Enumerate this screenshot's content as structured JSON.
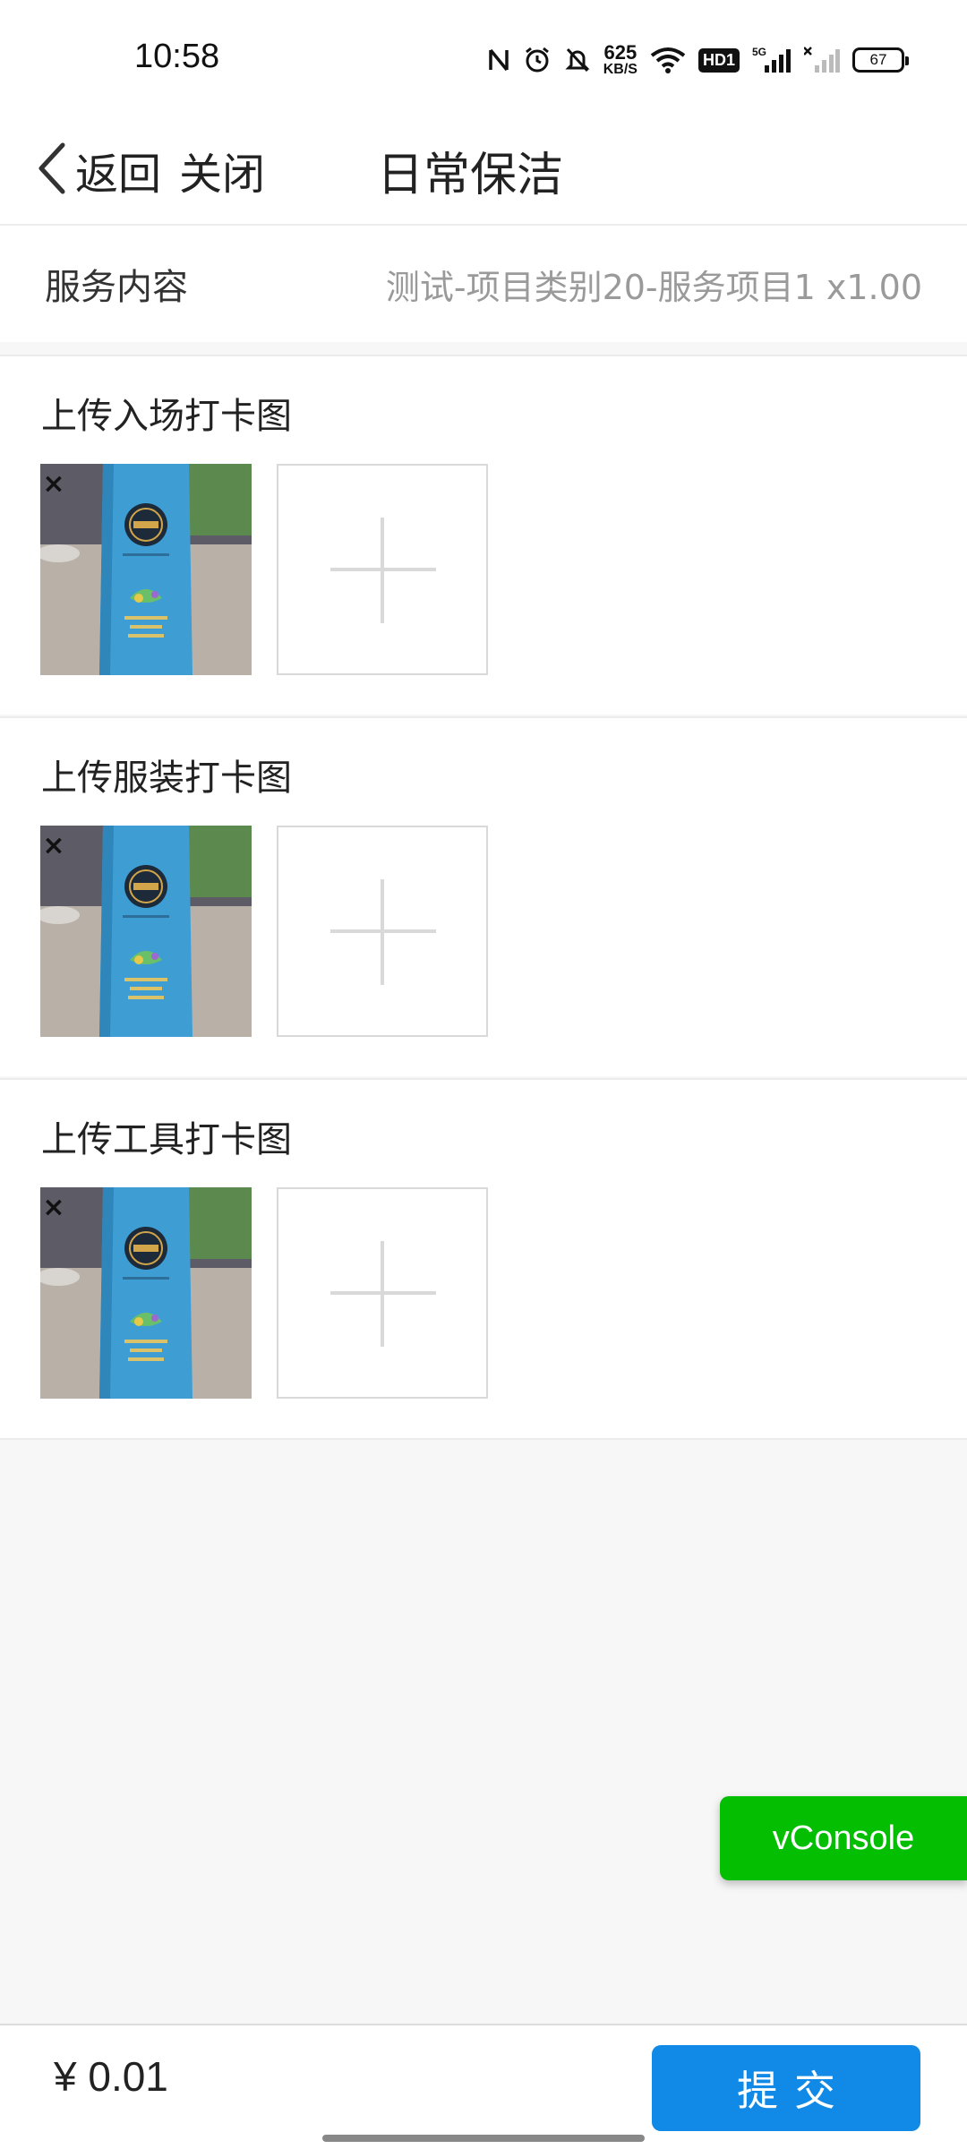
{
  "status_bar": {
    "time": "10:58",
    "net_speed_value": "625",
    "net_speed_unit": "KB/S",
    "hd_badge": "HD1",
    "signal_label": "5G",
    "battery_level": "67",
    "icons": [
      "nfc-icon",
      "alarm-icon",
      "mute-icon",
      "wifi-icon",
      "signal-icon",
      "signal-off-icon",
      "battery-icon"
    ]
  },
  "nav": {
    "back_label": "返回",
    "close_label": "关闭",
    "title": "日常保洁"
  },
  "service": {
    "label": "服务内容",
    "value": "测试-项目类别20-服务项目1 x1.00"
  },
  "sections": [
    {
      "title": "上传入场打卡图",
      "remove_label": "×"
    },
    {
      "title": "上传服装打卡图",
      "remove_label": "×"
    },
    {
      "title": "上传工具打卡图",
      "remove_label": "×"
    }
  ],
  "vconsole_label": "vConsole",
  "footer": {
    "price": "¥ 0.01",
    "submit_label": "提交"
  },
  "colors": {
    "submit": "#1189e6",
    "vconsole": "#04be02",
    "product_blue": "#3e9ed4"
  }
}
